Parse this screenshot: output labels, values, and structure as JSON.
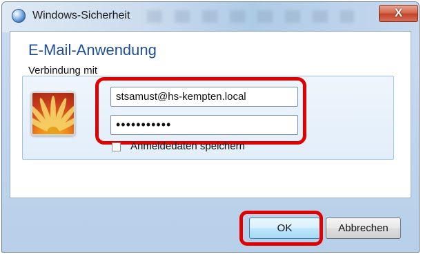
{
  "window": {
    "title": "Windows-Sicherheit",
    "close_label": "X"
  },
  "dialog": {
    "app_title": "E-Mail-Anwendung",
    "subtitle": "Verbindung mit"
  },
  "credentials": {
    "username": "stsamust@hs-kempten.local",
    "password_mask": "•••••••••••",
    "remember_label": "Anmeldedaten speichern",
    "remember_checked": false
  },
  "buttons": {
    "ok": "OK",
    "cancel": "Abbrechen"
  },
  "icons": {
    "title": "shield-globe-icon",
    "avatar": "user-flower-avatar-icon",
    "close": "close-icon"
  },
  "colors": {
    "highlight": "#e00000",
    "title_blue": "#1f4e94"
  }
}
